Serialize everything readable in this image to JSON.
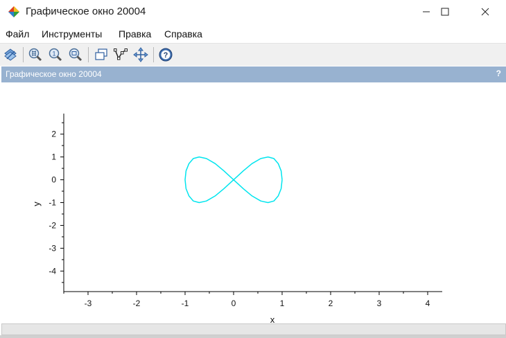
{
  "window": {
    "title": "Графическое окно 20004",
    "controls": {
      "minimize": "minimize",
      "maximize": "maximize",
      "close": "close"
    }
  },
  "menu": [
    {
      "label": "Файл"
    },
    {
      "label": "Инструменты"
    },
    {
      "label": "Правка"
    },
    {
      "label": "Справка"
    }
  ],
  "toolbar": {
    "buttons": [
      {
        "icon": "figure-properties-icon"
      },
      {
        "icon": "zoom-grid-icon"
      },
      {
        "icon": "zoom-reset-icon"
      },
      {
        "icon": "zoom-in-icon"
      },
      {
        "icon": "rotate-window-icon"
      },
      {
        "icon": "datatip-icon"
      },
      {
        "icon": "pan-move-icon"
      },
      {
        "icon": "help-icon"
      }
    ]
  },
  "dock": {
    "title": "Графическое окно 20004",
    "help": "?"
  },
  "colors": {
    "curve": "#00e5ee",
    "dock_bar": "#98b2d0",
    "axis": "#000000"
  },
  "chart_data": {
    "type": "line",
    "title": "",
    "xlabel": "x",
    "ylabel": "y",
    "xlim": [
      -3.5,
      4.3
    ],
    "ylim": [
      -4.9,
      2.9
    ],
    "x_ticks": [
      -3,
      -2,
      -1,
      0,
      1,
      2,
      3,
      4
    ],
    "y_ticks": [
      2,
      1,
      0,
      -1,
      -2,
      -3,
      -4
    ],
    "grid": false,
    "series": [
      {
        "curve": "lemniscate of Gerono",
        "x": [
          1,
          0.98,
          0.92,
          0.83,
          0.71,
          0.56,
          0.38,
          0.2,
          0,
          -0.2,
          -0.38,
          -0.56,
          -0.71,
          -0.83,
          -0.92,
          -0.98,
          -1,
          -0.98,
          -0.92,
          -0.83,
          -0.71,
          -0.56,
          -0.38,
          -0.2,
          0,
          0.2,
          0.38,
          0.56,
          0.71,
          0.83,
          0.92,
          0.98,
          1
        ],
        "y": [
          0,
          0.39,
          0.71,
          0.93,
          1,
          0.93,
          0.71,
          0.39,
          0,
          -0.39,
          -0.71,
          -0.93,
          -1,
          -0.93,
          -0.71,
          -0.39,
          0,
          0.39,
          0.71,
          0.93,
          1,
          0.93,
          0.71,
          0.39,
          0,
          -0.39,
          -0.71,
          -0.93,
          -1,
          -0.93,
          -0.71,
          -0.39,
          0
        ]
      }
    ]
  }
}
